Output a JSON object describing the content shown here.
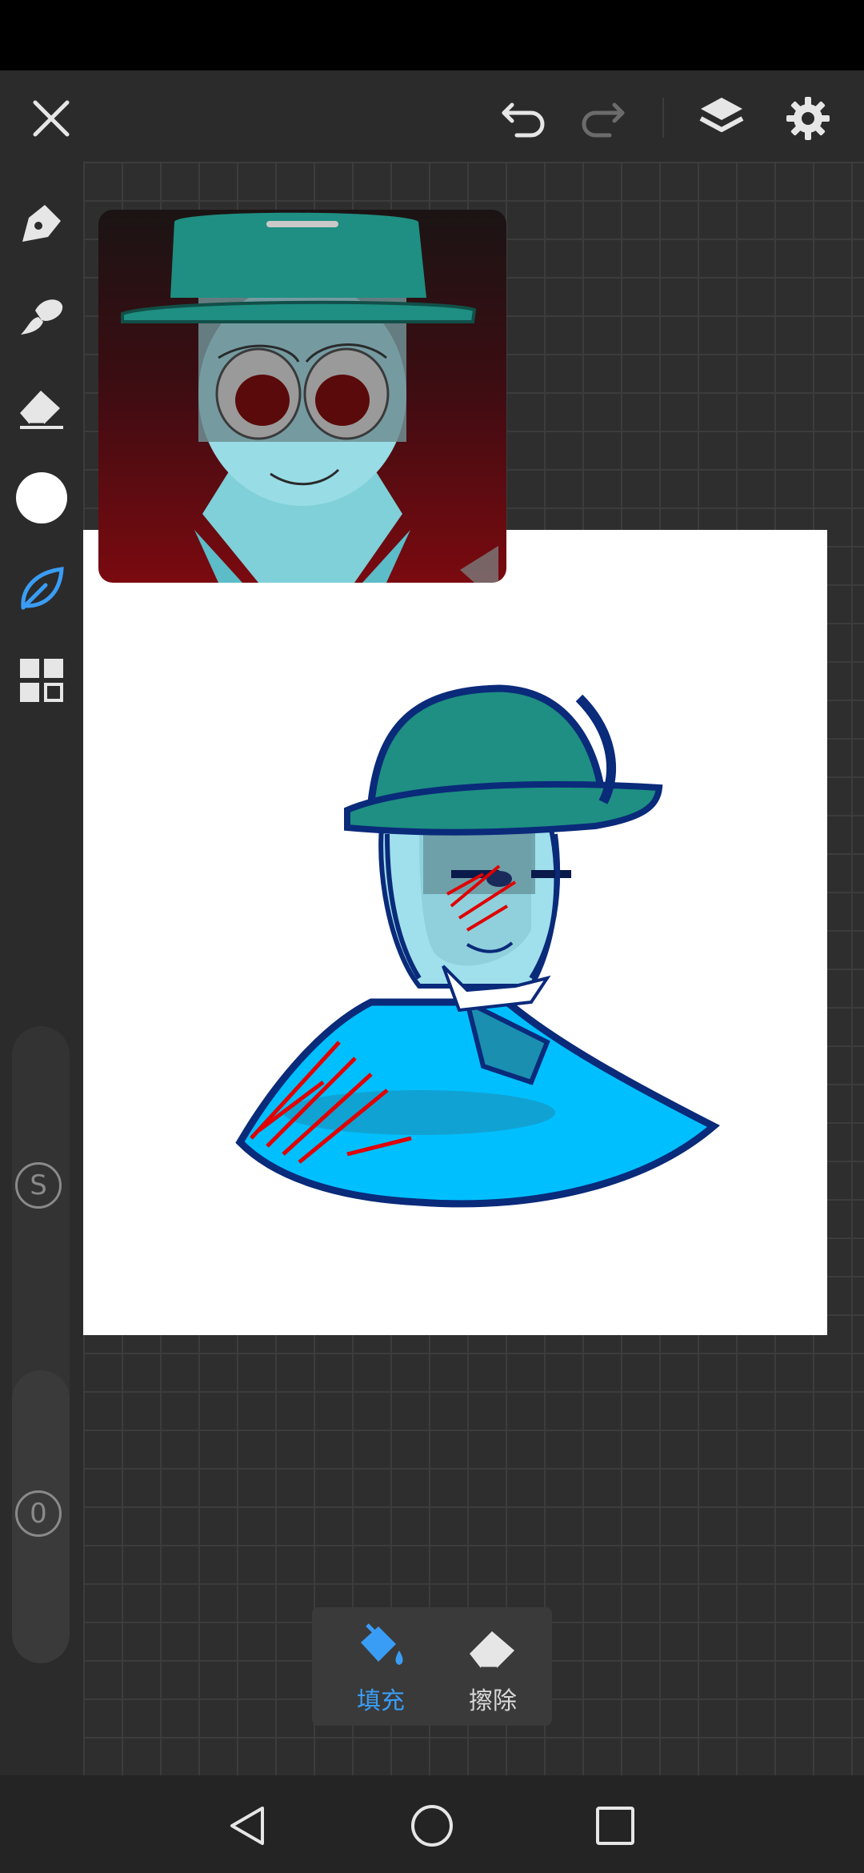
{
  "app": {
    "toolbar": {
      "close_icon": "close-icon",
      "undo_icon": "undo-icon",
      "redo_icon": "redo-icon",
      "layers_icon": "layers-icon",
      "settings_icon": "gear-icon"
    },
    "sidebar": {
      "tools": [
        "pen-icon",
        "brush-icon",
        "eraser-icon",
        "color-swatch",
        "leaf-brush-icon",
        "grid-menu-icon"
      ],
      "active_tool": "leaf-brush-icon",
      "current_color": "#ffffff",
      "size_slider_label": "S",
      "opacity_slider_label": "0"
    },
    "fill_panel": {
      "fill_label": "填充",
      "erase_label": "擦除",
      "active": "fill"
    },
    "colors": {
      "accent": "#3a9df5",
      "icon": "#e6e6e6",
      "disabled_icon": "#6b6b6b"
    }
  }
}
